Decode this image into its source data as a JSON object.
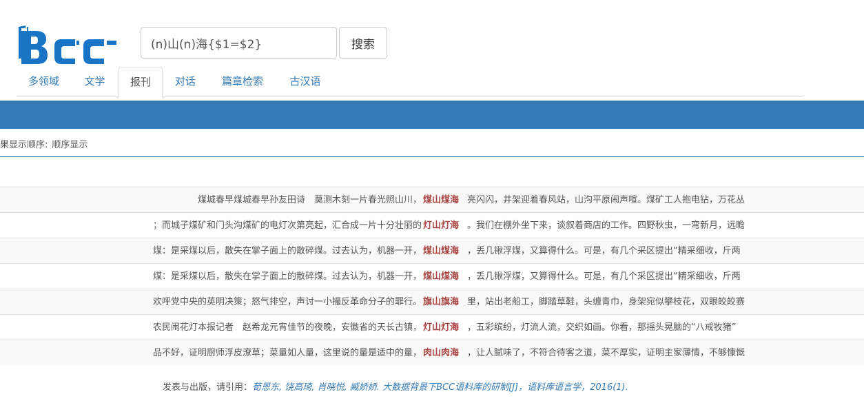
{
  "brand": {
    "logo_text": "Bcc",
    "logo_color": "#1a74c6"
  },
  "search": {
    "query": "(n)山(n)海{$1=$2}",
    "button_label": "搜索"
  },
  "tabs": [
    {
      "label": "多领域",
      "active": false
    },
    {
      "label": "文学",
      "active": false
    },
    {
      "label": "报刊",
      "active": true
    },
    {
      "label": "对话",
      "active": false
    },
    {
      "label": "篇章检索",
      "active": false
    },
    {
      "label": "古汉语",
      "active": false
    }
  ],
  "results_header": {
    "order_label": "果显示顺序:",
    "order_value": "顺序显示"
  },
  "results": [
    {
      "left": "煤城春早煤城春早孙友田诗　莫测木刻一片春光照山川，",
      "keyword": "煤山煤海",
      "right": "亮闪闪，井架迎着春风站，山沟平原闹声喧。煤矿工人抱电钻，万花丛"
    },
    {
      "left": "；而城子煤矿和门头沟煤矿的电灯次第亮起，汇合成一片十分壮丽的",
      "keyword": "灯山灯海",
      "right": "。我们在棚外坐下来，谈叙着商店的工作。四野秋虫，一弯新月，远瞻"
    },
    {
      "left": "煤：是采煤以后，散失在掌子面上的散碎煤。过去认为，机器一开，",
      "keyword": "煤山煤海",
      "right": "，丢几锹浮煤，又算得什么。可是，有几个采区提出“精采细收，斤两"
    },
    {
      "left": "煤：是采煤以后，散失在掌子面上的散碎煤。过去认为，机器一开，",
      "keyword": "煤山煤海",
      "right": "，丢几锹浮煤，又算得什么。可是，有几个采区提出“精采细收，斤两"
    },
    {
      "left": "欢呼党中央的英明决策；怒气排空，声讨一小撮反革命分子的罪行。",
      "keyword": "旗山旗海",
      "right": "里，站出老船工，脚踏草鞋，头缠青巾，身架宛似攀枝花，双眼皎皎赛"
    },
    {
      "left": "农民闹花灯本报记者　赵希龙元宵佳节的夜晚，安徽省的天长古镇，",
      "keyword": "灯山灯海",
      "right": "，五彩缤纷，灯流人流，交织如画。你看，那摇头晃脑的“八戒牧猪”"
    },
    {
      "left": "品不好，证明厨师浮皮潦草；菜量如人量，这里说的量是适中的量，",
      "keyword": "肉山肉海",
      "right": "，让人腻味了，不符合待客之道，菜不厚实，证明主家薄情，不够慷慨"
    }
  ],
  "footer": {
    "prefix": "发表与出版，请引用：",
    "citation": "荀恩东, 饶高琦, 肖晓悦, 臧娇娇. 大数据背景下BCC语料库的研制[J]，语料库语言学，2016(1)."
  }
}
